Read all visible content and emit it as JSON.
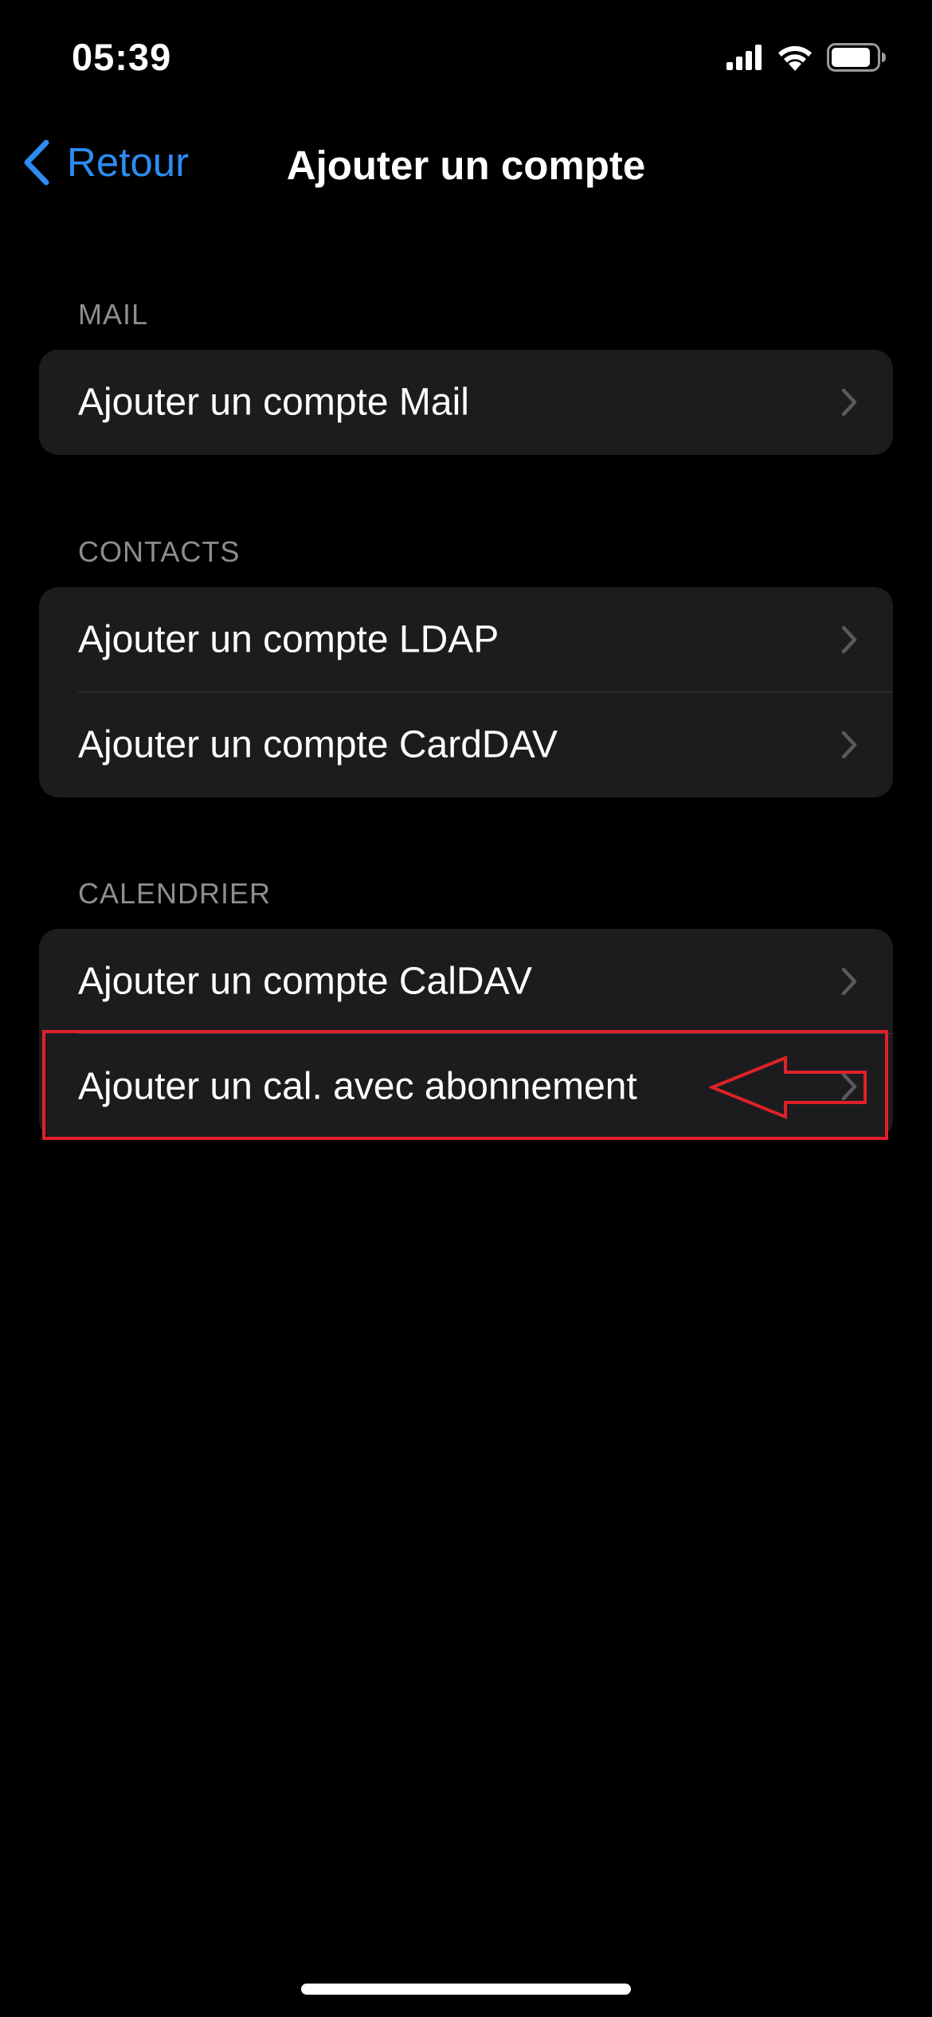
{
  "status_bar": {
    "time": "05:39"
  },
  "nav": {
    "back_label": "Retour",
    "title": "Ajouter un compte"
  },
  "sections": {
    "mail": {
      "header": "MAIL",
      "rows": [
        "Ajouter un compte Mail"
      ]
    },
    "contacts": {
      "header": "CONTACTS",
      "rows": [
        "Ajouter un compte LDAP",
        "Ajouter un compte CardDAV"
      ]
    },
    "calendar": {
      "header": "CALENDRIER",
      "rows": [
        "Ajouter un compte CalDAV",
        "Ajouter un cal. avec abonnement"
      ]
    }
  },
  "colors": {
    "background": "#000000",
    "group_background": "#1c1c1e",
    "accent": "#2d8cf0",
    "section_header": "#8d8d92",
    "chevron": "#5a5a5e",
    "annotation": "#e02128"
  },
  "icons": [
    "signal-icon",
    "wifi-icon",
    "battery-icon",
    "chevron-left-icon",
    "chevron-right-icon",
    "annotation-arrow-icon"
  ]
}
